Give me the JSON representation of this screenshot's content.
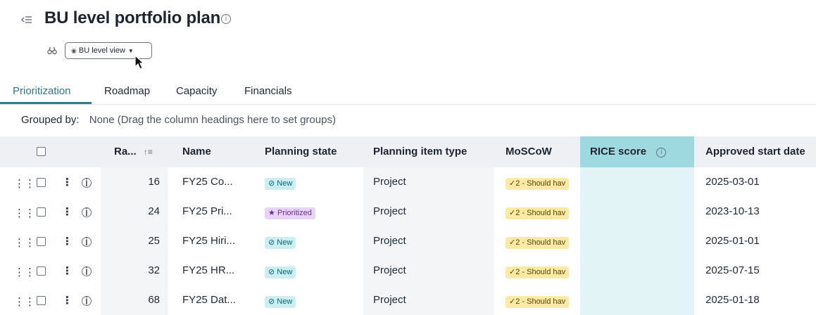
{
  "page": {
    "title": "BU level portfolio plan",
    "info_glyph": "i"
  },
  "view_selector": {
    "label": "BU level view"
  },
  "tabs": [
    {
      "label": "Prioritization",
      "active": true
    },
    {
      "label": "Roadmap",
      "active": false
    },
    {
      "label": "Capacity",
      "active": false
    },
    {
      "label": "Financials",
      "active": false
    }
  ],
  "grouping": {
    "label": "Grouped by:",
    "hint": "None (Drag the column headings here to set groups)"
  },
  "table": {
    "columns": {
      "rank": "Ra...",
      "rank_sort_glyph": "↑≡",
      "name": "Name",
      "planning_state": "Planning state",
      "item_type": "Planning item type",
      "moscow": "MoSCoW",
      "rice": "RICE score",
      "start_date": "Approved start date"
    },
    "rows": [
      {
        "rank": "16",
        "name": "FY25 Co...",
        "state": "New",
        "type": "Project",
        "moscow": "2 - Should hav",
        "rice": "",
        "start": "2025-03-01"
      },
      {
        "rank": "24",
        "name": "FY25 Pri...",
        "state": "Prioritized",
        "type": "Project",
        "moscow": "2 - Should hav",
        "rice": "",
        "start": "2023-10-13"
      },
      {
        "rank": "25",
        "name": "FY25 Hiri...",
        "state": "New",
        "type": "Project",
        "moscow": "2 - Should hav",
        "rice": "",
        "start": "2025-01-01"
      },
      {
        "rank": "32",
        "name": "FY25 HR...",
        "state": "New",
        "type": "Project",
        "moscow": "2 - Should hav",
        "rice": "",
        "start": "2025-07-15"
      },
      {
        "rank": "68",
        "name": "FY25 Dat...",
        "state": "New",
        "type": "Project",
        "moscow": "2 - Should hav",
        "rice": "",
        "start": "2025-01-18"
      }
    ]
  },
  "colors": {
    "accent": "#2b7a90",
    "link": "#4a5fc1",
    "rice_header": "#9dd9de",
    "badge_new": "#cdeef0",
    "badge_prioritized": "#e7d3f5",
    "badge_moscow": "#fde9a6"
  },
  "icons": {
    "collapse": "collapse-sidebar-icon",
    "binoculars": "binoculars-icon",
    "eye": "eye-icon",
    "drag": "drag-handle-icon",
    "kebab": "kebab-menu-icon",
    "info": "info-icon",
    "state_new": "tag-icon",
    "state_prioritized": "star-icon",
    "moscow": "checkmark-icon"
  }
}
